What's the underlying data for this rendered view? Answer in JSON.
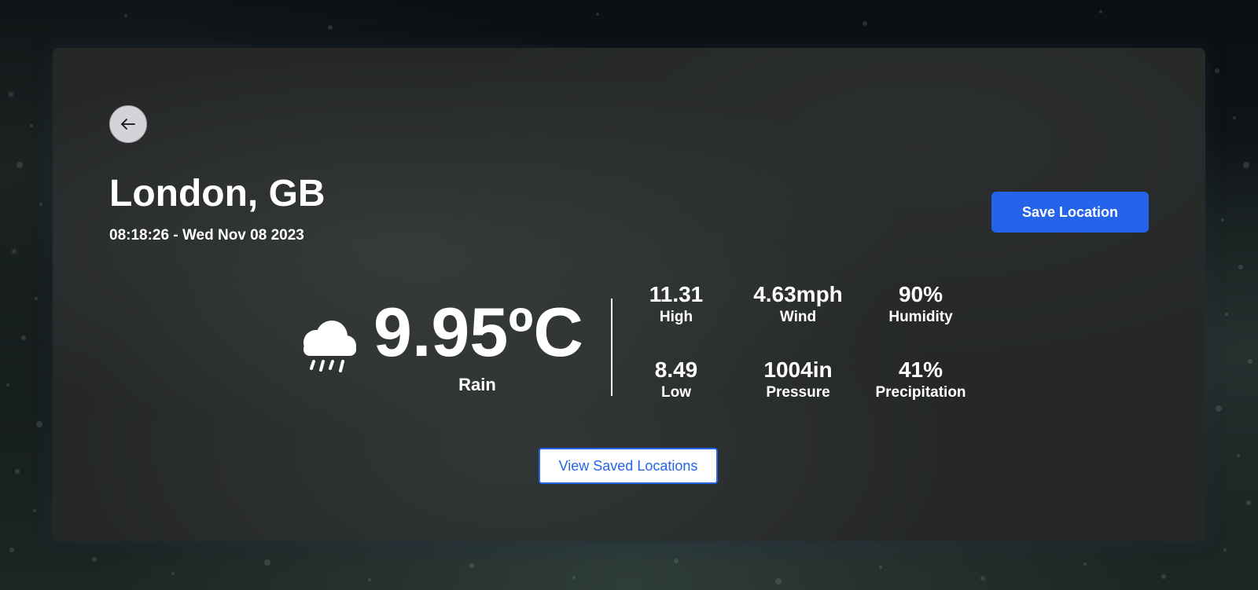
{
  "location": {
    "city": "London, GB",
    "datetime": "08:18:26 - Wed Nov 08 2023"
  },
  "actions": {
    "save_label": "Save Location",
    "view_saved_label": "View Saved Locations"
  },
  "current": {
    "temperature": "9.95ºC",
    "condition": "Rain",
    "icon": "rain-cloud-icon"
  },
  "stats": [
    {
      "value": "11.31",
      "label": "High"
    },
    {
      "value": "4.63mph",
      "label": "Wind"
    },
    {
      "value": "90%",
      "label": "Humidity"
    },
    {
      "value": "8.49",
      "label": "Low"
    },
    {
      "value": "1004in",
      "label": "Pressure"
    },
    {
      "value": "41%",
      "label": "Precipitation"
    }
  ],
  "colors": {
    "accent": "#2563eb",
    "card_background": "#262828",
    "back_button": "#d4d4d8"
  }
}
